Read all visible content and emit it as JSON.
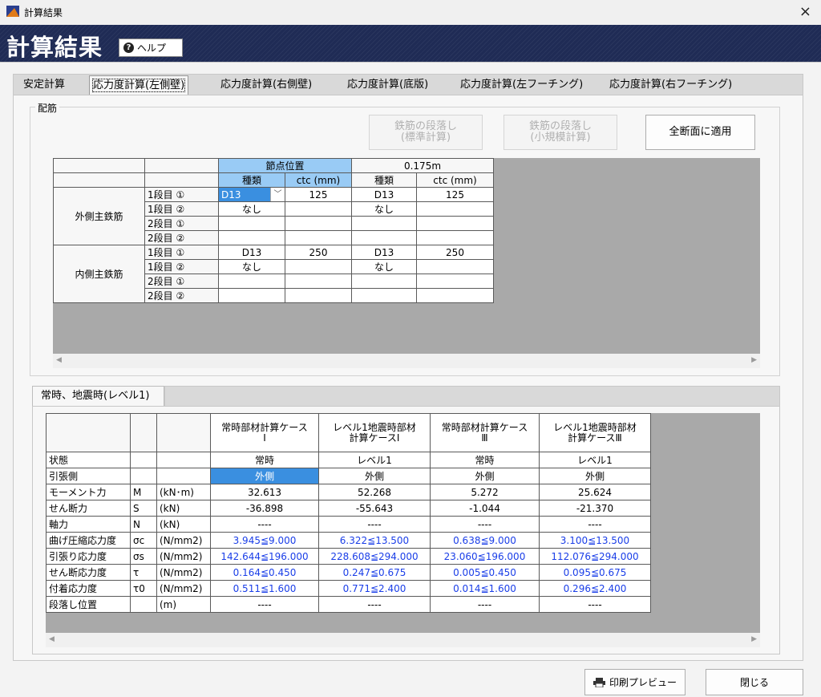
{
  "window": {
    "title": "計算結果",
    "close": "×"
  },
  "banner": {
    "title": "計算結果",
    "help": "ヘルプ",
    "help_icon": "?"
  },
  "tabs": [
    "安定計算",
    "応力度計算(左側壁)",
    "応力度計算(右側壁)",
    "応力度計算(底版)",
    "応力度計算(左フーチング)",
    "応力度計算(右フーチング)"
  ],
  "rebar": {
    "group_label": "配筋",
    "btn_standard": "鉄筋の段落し\n(標準計算)",
    "btn_small": "鉄筋の段落し\n(小規模計算)",
    "btn_apply": "全断面に適用",
    "col_node": "節点位置",
    "col_pos2": "0.175m",
    "col_type": "種類",
    "col_ctc": "ctc (mm)",
    "outer_label": "外側主鉄筋",
    "inner_label": "内側主鉄筋",
    "row_labels": [
      "1段目 ①",
      "1段目 ②",
      "2段目 ①",
      "2段目 ②"
    ],
    "outer": [
      [
        "D13",
        "125",
        "D13",
        "125"
      ],
      [
        "なし",
        "",
        "なし",
        ""
      ],
      [
        "",
        "",
        "",
        ""
      ],
      [
        "",
        "",
        "",
        ""
      ]
    ],
    "inner": [
      [
        "D13",
        "250",
        "D13",
        "250"
      ],
      [
        "なし",
        "",
        "なし",
        ""
      ],
      [
        "",
        "",
        "",
        ""
      ],
      [
        "",
        "",
        "",
        ""
      ]
    ],
    "dropdown_arrow": "﹀"
  },
  "results": {
    "subtab": "常時、地震時(レベル1)",
    "col_heads": [
      "常時部材計算ケース\nⅠ",
      "レベル1地震時部材\n計算ケースⅠ",
      "常時部材計算ケース\nⅢ",
      "レベル1地震時部材\n計算ケースⅢ"
    ],
    "rows": [
      {
        "label": "状態",
        "sym": "",
        "unit": "",
        "vals": [
          "常時",
          "レベル1",
          "常時",
          "レベル1"
        ],
        "blue": false
      },
      {
        "label": "引張側",
        "sym": "",
        "unit": "",
        "vals": [
          "外側",
          "外側",
          "外側",
          "外側"
        ],
        "blue": false
      },
      {
        "label": "モーメント力",
        "sym": "M",
        "unit": "(kN･m)",
        "vals": [
          "32.613",
          "52.268",
          "5.272",
          "25.624"
        ],
        "blue": false
      },
      {
        "label": "せん断力",
        "sym": "S",
        "unit": "(kN)",
        "vals": [
          "-36.898",
          "-55.643",
          "-1.044",
          "-21.370"
        ],
        "blue": false
      },
      {
        "label": "軸力",
        "sym": "N",
        "unit": "(kN)",
        "vals": [
          "----",
          "----",
          "----",
          "----"
        ],
        "blue": false
      },
      {
        "label": "曲げ圧縮応力度",
        "sym": "σc",
        "unit": "(N/mm2)",
        "vals": [
          "3.945≦9.000",
          "6.322≦13.500",
          "0.638≦9.000",
          "3.100≦13.500"
        ],
        "blue": true
      },
      {
        "label": "引張り応力度",
        "sym": "σs",
        "unit": "(N/mm2)",
        "vals": [
          "142.644≦196.000",
          "228.608≦294.000",
          "23.060≦196.000",
          "112.076≦294.000"
        ],
        "blue": true
      },
      {
        "label": "せん断応力度",
        "sym": "τ",
        "unit": "(N/mm2)",
        "vals": [
          "0.164≦0.450",
          "0.247≦0.675",
          "0.005≦0.450",
          "0.095≦0.675"
        ],
        "blue": true
      },
      {
        "label": "付着応力度",
        "sym": "τ0",
        "unit": "(N/mm2)",
        "vals": [
          "0.511≦1.600",
          "0.771≦2.400",
          "0.014≦1.600",
          "0.296≦2.400"
        ],
        "blue": true
      },
      {
        "label": "段落し位置",
        "sym": "",
        "unit": "(m)",
        "vals": [
          "----",
          "----",
          "----",
          "----"
        ],
        "blue": false
      }
    ]
  },
  "footer": {
    "print": "印刷プレビュー",
    "close": "閉じる"
  },
  "colors": {
    "banner": "#1f2b55",
    "selected": "#3a8fe0",
    "header_selected": "#99cbf5",
    "value_blue": "#1a3ee8"
  },
  "icons": {
    "app": "app-icon",
    "help": "help-icon",
    "print": "printer-icon"
  }
}
